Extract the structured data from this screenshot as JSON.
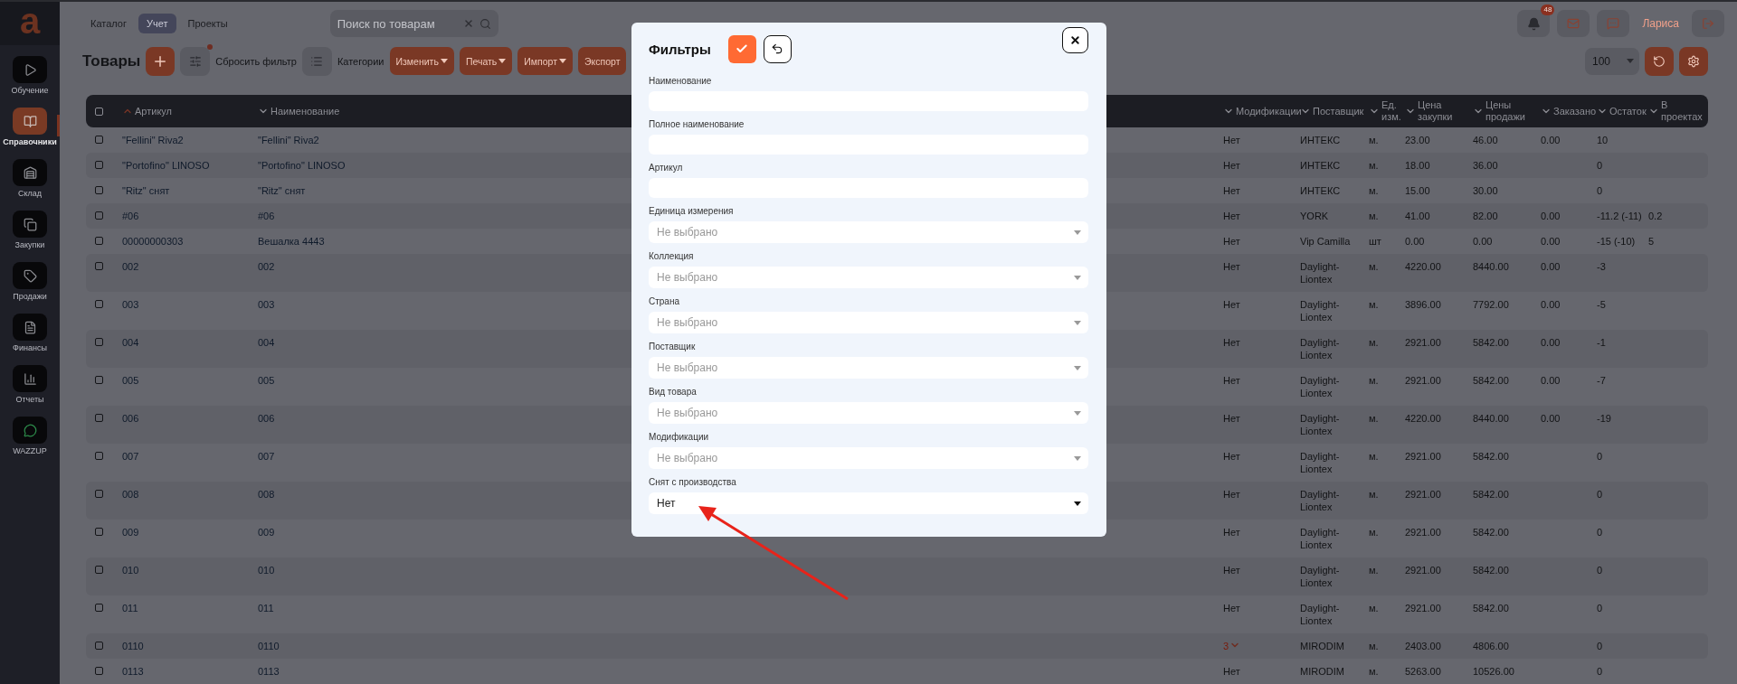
{
  "sidebar": {
    "logo": "a",
    "items": [
      {
        "label": "Обучение",
        "selected": false
      },
      {
        "label": "Справочники",
        "selected": true
      },
      {
        "label": "Склад",
        "selected": false
      },
      {
        "label": "Закупки",
        "selected": false
      },
      {
        "label": "Продажи",
        "selected": false
      },
      {
        "label": "Финансы",
        "selected": false
      },
      {
        "label": "Отчеты",
        "selected": false
      },
      {
        "label": "WAZZUP",
        "selected": false
      }
    ]
  },
  "topbar": {
    "tabs": [
      {
        "label": "Каталог",
        "selected": false
      },
      {
        "label": "Учет",
        "selected": true
      },
      {
        "label": "Проекты",
        "selected": false
      }
    ],
    "search": {
      "placeholder": "Поиск по товарам"
    },
    "notifications_badge": "48",
    "user": "Лариса"
  },
  "toolbar": {
    "title": "Товары",
    "filter_active": true,
    "reset_filter": "Сбросить фильтр",
    "categories": "Категории",
    "actions": [
      {
        "label": "Изменить",
        "dropdown": true
      },
      {
        "label": "Печать",
        "dropdown": true
      },
      {
        "label": "Импорт",
        "dropdown": true
      },
      {
        "label": "Экспорт",
        "dropdown": false
      }
    ],
    "page_size": "100"
  },
  "table": {
    "all_checked": false,
    "columns": [
      {
        "label": "Артикул",
        "sorted": true
      },
      {
        "label": "Наименование",
        "sorted": false
      },
      {
        "label": "Модификации",
        "sorted": false
      },
      {
        "label": "Поставщик",
        "sorted": false
      },
      {
        "label": "Ед. изм.",
        "sorted": false
      },
      {
        "label": "Цена закупки",
        "sorted": false
      },
      {
        "label": "Цены продажи",
        "sorted": false
      },
      {
        "label": "Заказано",
        "sorted": false
      },
      {
        "label": "Остаток",
        "sorted": false
      },
      {
        "label": "В проектах",
        "sorted": false
      }
    ],
    "rows": [
      {
        "checked": false,
        "mods_expandable": false,
        "cells": [
          "\"Fellini\" Riva2",
          "\"Fellini\" Riva2",
          "Нет",
          "ИНТЕКС",
          "м.",
          "23.00",
          "46.00",
          "0.00",
          "10",
          null
        ]
      },
      {
        "checked": false,
        "mods_expandable": false,
        "cells": [
          "\"Portofino\" LINOSO",
          "\"Portofino\" LINOSO",
          "Нет",
          "ИНТЕКС",
          "м.",
          "18.00",
          "36.00",
          null,
          "0",
          null
        ]
      },
      {
        "checked": false,
        "mods_expandable": false,
        "cells": [
          "\"Ritz\" снят",
          "\"Ritz\" снят",
          "Нет",
          "ИНТЕКС",
          "м.",
          "15.00",
          "30.00",
          null,
          "0",
          null
        ]
      },
      {
        "checked": false,
        "mods_expandable": false,
        "cells": [
          "#06",
          "#06",
          "Нет",
          "YORK",
          "м.",
          "41.00",
          "82.00",
          "0.00",
          "-11.2 (-11)",
          "0.2"
        ]
      },
      {
        "checked": false,
        "mods_expandable": false,
        "cells": [
          "00000000303",
          "Вешалка 4443",
          "Нет",
          "Vip Camilla",
          "шт",
          "0.00",
          "0.00",
          "0.00",
          "-15 (-10)",
          "5"
        ]
      },
      {
        "checked": false,
        "mods_expandable": false,
        "cells": [
          "002",
          "002",
          "Нет",
          "Daylight-Liontex",
          "м.",
          "4220.00",
          "8440.00",
          "0.00",
          "-3",
          null
        ]
      },
      {
        "checked": false,
        "mods_expandable": false,
        "cells": [
          "003",
          "003",
          "Нет",
          "Daylight-Liontex",
          "м.",
          "3896.00",
          "7792.00",
          "0.00",
          "-5",
          null
        ]
      },
      {
        "checked": false,
        "mods_expandable": false,
        "cells": [
          "004",
          "004",
          "Нет",
          "Daylight-Liontex",
          "м.",
          "2921.00",
          "5842.00",
          "0.00",
          "-1",
          null
        ]
      },
      {
        "checked": false,
        "mods_expandable": false,
        "cells": [
          "005",
          "005",
          "Нет",
          "Daylight-Liontex",
          "м.",
          "2921.00",
          "5842.00",
          "0.00",
          "-7",
          null
        ]
      },
      {
        "checked": false,
        "mods_expandable": false,
        "cells": [
          "006",
          "006",
          "Нет",
          "Daylight-Liontex",
          "м.",
          "4220.00",
          "8440.00",
          "0.00",
          "-19",
          null
        ]
      },
      {
        "checked": false,
        "mods_expandable": false,
        "cells": [
          "007",
          "007",
          "Нет",
          "Daylight-Liontex",
          "м.",
          "2921.00",
          "5842.00",
          null,
          "0",
          null
        ]
      },
      {
        "checked": false,
        "mods_expandable": false,
        "cells": [
          "008",
          "008",
          "Нет",
          "Daylight-Liontex",
          "м.",
          "2921.00",
          "5842.00",
          null,
          "0",
          null
        ]
      },
      {
        "checked": false,
        "mods_expandable": false,
        "cells": [
          "009",
          "009",
          "Нет",
          "Daylight-Liontex",
          "м.",
          "2921.00",
          "5842.00",
          null,
          "0",
          null
        ]
      },
      {
        "checked": false,
        "mods_expandable": false,
        "cells": [
          "010",
          "010",
          "Нет",
          "Daylight-Liontex",
          "м.",
          "2921.00",
          "5842.00",
          null,
          "0",
          null
        ]
      },
      {
        "checked": false,
        "mods_expandable": false,
        "cells": [
          "011",
          "011",
          "Нет",
          "Daylight-Liontex",
          "м.",
          "2921.00",
          "5842.00",
          null,
          "0",
          null
        ]
      },
      {
        "checked": false,
        "mods_expandable": true,
        "cells": [
          "0110",
          "0110",
          "3",
          "MIRODIM",
          "м.",
          "2403.00",
          "4806.00",
          null,
          "0",
          null
        ]
      },
      {
        "checked": false,
        "mods_expandable": false,
        "cells": [
          "0113",
          "0113",
          "Нет",
          "MIRODIM",
          "м.",
          "5263.00",
          "10526.00",
          null,
          "0",
          null
        ]
      }
    ]
  },
  "filters": {
    "title": "Фильтры",
    "fields": [
      {
        "label": "Наименование",
        "kind": "text"
      },
      {
        "label": "Полное наименование",
        "kind": "text"
      },
      {
        "label": "Артикул",
        "kind": "text"
      },
      {
        "label": "Единица измерения",
        "kind": "select",
        "placeholder": "Не выбрано"
      },
      {
        "label": "Коллекция",
        "kind": "select",
        "placeholder": "Не выбрано"
      },
      {
        "label": "Страна",
        "kind": "select",
        "placeholder": "Не выбрано"
      },
      {
        "label": "Поставщик",
        "kind": "select",
        "placeholder": "Не выбрано"
      },
      {
        "label": "Вид товара",
        "kind": "select",
        "placeholder": "Не выбрано"
      },
      {
        "label": "Модификации",
        "kind": "select",
        "placeholder": "Не выбрано"
      },
      {
        "label": "Снят с производства",
        "kind": "select",
        "value": "Нет"
      }
    ]
  }
}
